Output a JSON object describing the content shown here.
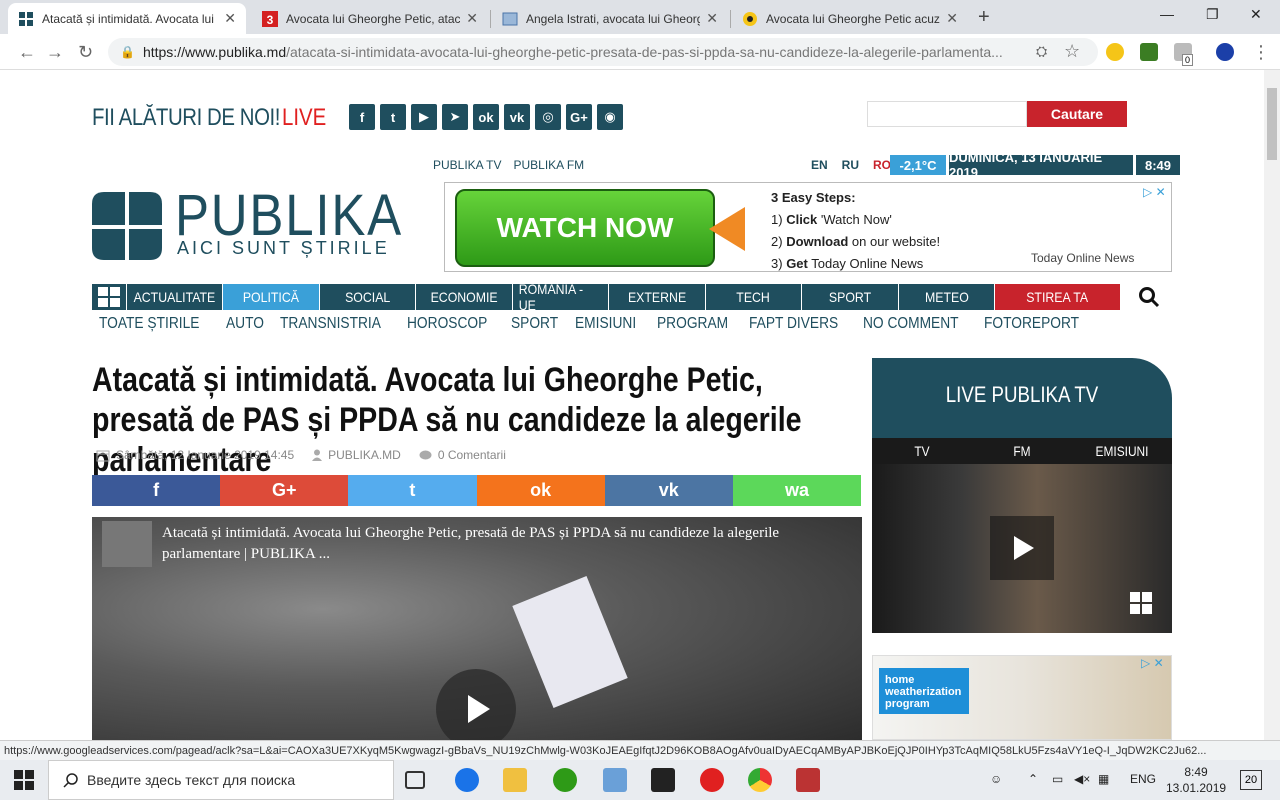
{
  "browser": {
    "tabs": [
      {
        "title": "Atacată și intimidată. Avocata lui",
        "active": true
      },
      {
        "title": "Avocata lui Gheorghe Petic, atac",
        "active": false
      },
      {
        "title": "Angela Istrati, avocata lui Gheorg",
        "active": false
      },
      {
        "title": "Avocata lui Gheorghe Petic acuz",
        "active": false
      }
    ],
    "url_domain": "https://www.publika.md",
    "url_path": "/atacata-si-intimidata-avocata-lui-gheorghe-petic-presata-de-pas-si-ppda-sa-nu-candideze-la-alegerile-parlamenta...",
    "status_url": "https://www.googleadservices.com/pagead/aclk?sa=L&ai=CAOXa3UE7XKyqM5KwgwagzI-gBbaVs_NU19zChMwlg-W03KoJEAEgIfqtJ2D96KOB8AOgAfv0uaIDyAECqAMByAPJBKoEjQJP0IHYp3TcAqMIQ58LkU5Fzs4aVY1eQ-I_JqDW2KC2Ju62...",
    "ext_badge": "0"
  },
  "header": {
    "join_text": "FII ALĂTURI DE NOI!",
    "live_text": "LIVE",
    "search_button": "Cautare",
    "sublinks": [
      "PUBLIKA TV",
      "PUBLIKA FM"
    ],
    "langs": [
      "EN",
      "RU",
      "RO"
    ],
    "temperature": "-2,1°C",
    "date": "DUMINICĂ, 13 IANUARIE 2019",
    "time": "8:49",
    "logo_name": "PUBLIKA",
    "logo_tagline": "AICI SUNT ȘTIRILE",
    "social_icons": [
      "f",
      "t",
      "▶",
      "➤",
      "ok",
      "vk",
      "◎",
      "G+",
      "◉"
    ]
  },
  "ad_top": {
    "cta": "WATCH NOW",
    "steps_title": "3 Easy Steps:",
    "steps": [
      {
        "num": "1)",
        "bold": "Click",
        "rest": " 'Watch Now'"
      },
      {
        "num": "2)",
        "bold": "Download",
        "rest": " on our website!"
      },
      {
        "num": "3)",
        "bold": "Get",
        "rest": " Today Online News"
      }
    ],
    "brand": "Today Online News"
  },
  "nav": {
    "main": [
      {
        "label": "ACTUALITATE",
        "width": 96,
        "style": "normal"
      },
      {
        "label": "POLITICĂ",
        "width": 97,
        "style": "active"
      },
      {
        "label": "SOCIAL",
        "width": 96,
        "style": "normal"
      },
      {
        "label": "ECONOMIE",
        "width": 97,
        "style": "normal"
      },
      {
        "label": "ROMÂNIA - UE",
        "width": 96,
        "style": "normal"
      },
      {
        "label": "EXTERNE",
        "width": 97,
        "style": "normal"
      },
      {
        "label": "TECH",
        "width": 96,
        "style": "normal"
      },
      {
        "label": "SPORT",
        "width": 97,
        "style": "normal"
      },
      {
        "label": "METEO",
        "width": 96,
        "style": "normal"
      },
      {
        "label": "STIREA TA",
        "width": 126,
        "style": "red"
      }
    ],
    "sub": [
      "TOATE ȘTIRILE",
      "AUTO",
      "TRANSNISTRIA",
      "HOROSCOP",
      "SPORT",
      "EMISIUNI",
      "PROGRAM",
      "FAPT DIVERS",
      "NO COMMENT",
      "FOTOREPORT"
    ]
  },
  "article": {
    "headline": "Atacată și intimidată. Avocata lui Gheorghe Petic, presată de PAS și PPDA să nu candideze la alegerile parlamentare",
    "date": "Sâmbătă, 12 Ianuarie 2019 14:45",
    "author": "PUBLIKA.MD",
    "comments": "0 Comentarii",
    "video_title": "Atacată și intimidată. Avocata lui Gheorghe Petic, presată de PAS și PPDA să nu candideze la alegerile parlamentare | PUBLIKA ..."
  },
  "share": [
    {
      "label": "f",
      "color": "#3b5998"
    },
    {
      "label": "G+",
      "color": "#dd4b39"
    },
    {
      "label": "t",
      "color": "#55acee"
    },
    {
      "label": "ok",
      "color": "#f4731c"
    },
    {
      "label": "vk",
      "color": "#4c75a3"
    },
    {
      "label": "wa",
      "color": "#5cd85a"
    }
  ],
  "live_panel": {
    "title": "LIVE PUBLIKA TV",
    "tabs": [
      "TV",
      "FM",
      "EMISIUNI"
    ]
  },
  "ad_side": {
    "text": "home weatherization program"
  },
  "taskbar": {
    "search_placeholder": "Введите здесь текст для поиска",
    "lang": "ENG",
    "time": "8:49",
    "date": "13.01.2019",
    "notifications": "20"
  },
  "colors": {
    "brand": "#1f4e5e",
    "accent": "#3aa0d8",
    "red": "#c8232c"
  }
}
